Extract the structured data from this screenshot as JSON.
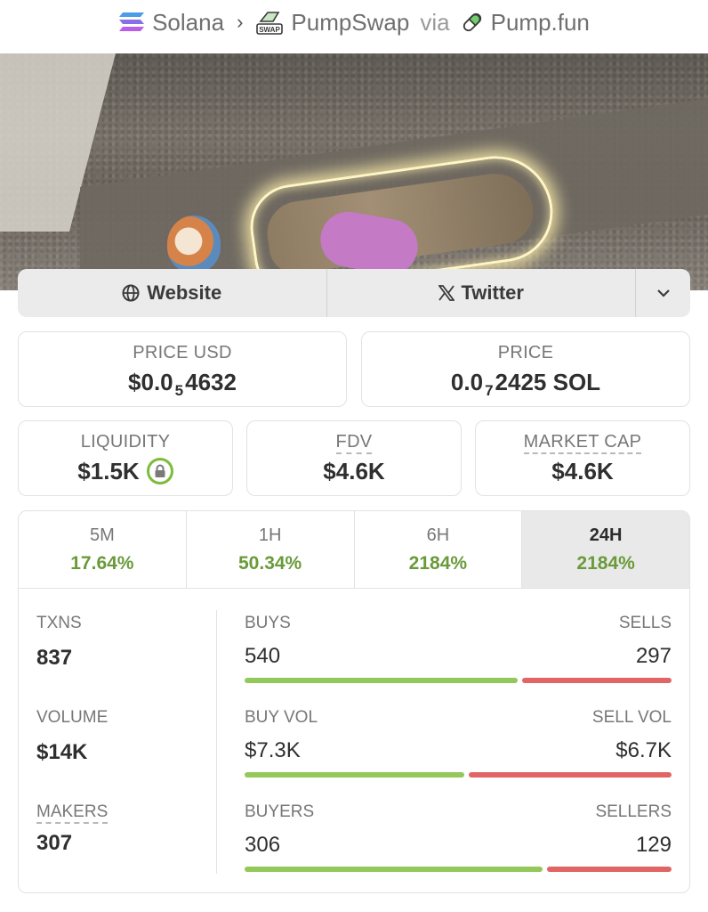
{
  "breadcrumb": {
    "chain": "Solana",
    "dex": "PumpSwap",
    "via": "via",
    "launchpad": "Pump.fun",
    "swap_badge": "SWAP"
  },
  "links": {
    "website": "Website",
    "twitter": "Twitter"
  },
  "price_usd": {
    "label": "PRICE USD",
    "prefix": "$0.0",
    "zeros": "5",
    "digits": "4632"
  },
  "price_sol": {
    "label": "PRICE",
    "prefix": "0.0",
    "zeros": "7",
    "digits": "2425 SOL"
  },
  "liquidity": {
    "label": "LIQUIDITY",
    "value": "$1.5K"
  },
  "fdv": {
    "label": "FDV",
    "value": "$4.6K"
  },
  "market_cap": {
    "label": "MARKET CAP",
    "value": "$4.6K"
  },
  "timeframes": [
    {
      "label": "5M",
      "change": "17.64%"
    },
    {
      "label": "1H",
      "change": "50.34%"
    },
    {
      "label": "6H",
      "change": "2184%"
    },
    {
      "label": "24H",
      "change": "2184%"
    }
  ],
  "stats": {
    "txns": {
      "label": "TXNS",
      "value": "837"
    },
    "volume": {
      "label": "VOLUME",
      "value": "$14K"
    },
    "makers": {
      "label": "MAKERS",
      "value": "307"
    },
    "buys": {
      "label": "BUYS",
      "value": "540",
      "sell_label": "SELLS",
      "sell_value": "297",
      "buy_fraction": 0.645
    },
    "vol": {
      "label": "BUY VOL",
      "value": "$7.3K",
      "sell_label": "SELL VOL",
      "sell_value": "$6.7K",
      "buy_fraction": 0.52
    },
    "buyers": {
      "label": "BUYERS",
      "value": "306",
      "sell_label": "SELLERS",
      "sell_value": "129",
      "buy_fraction": 0.703
    }
  },
  "colors": {
    "positive": "#6a9a3a",
    "buy_bar": "#93c85a",
    "sell_bar": "#e26565",
    "lock": "#7dbb3c"
  }
}
